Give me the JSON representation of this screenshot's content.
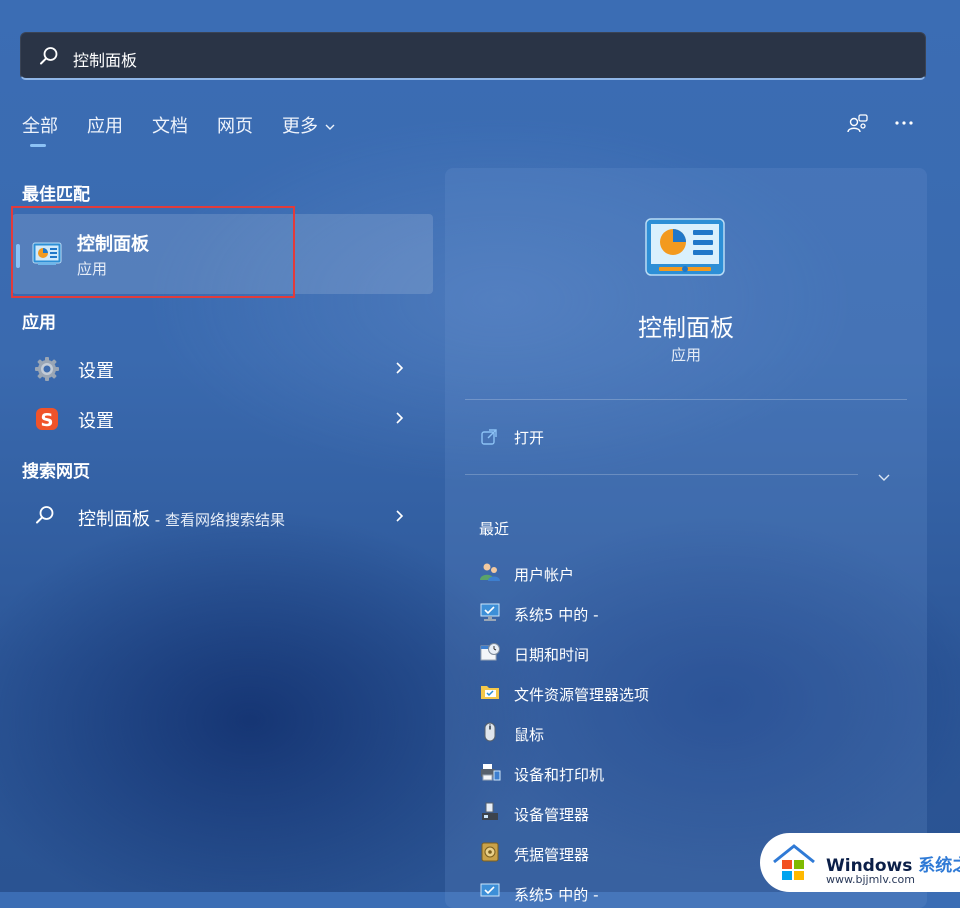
{
  "search": {
    "query": "控制面板"
  },
  "tabs": [
    {
      "label": "全部",
      "active": true
    },
    {
      "label": "应用"
    },
    {
      "label": "文档"
    },
    {
      "label": "网页"
    },
    {
      "label": "更多"
    }
  ],
  "top_icons": [
    "account-switch-icon",
    "more-options-icon"
  ],
  "best_match": {
    "section_title": "最佳匹配",
    "name": "控制面板",
    "type": "应用",
    "icon": "control-panel-icon"
  },
  "apps": {
    "section_title": "应用",
    "items": [
      {
        "label": "设置",
        "icon": "gear-icon"
      },
      {
        "label": "设置",
        "icon": "sogou-s-icon"
      }
    ]
  },
  "web_search": {
    "section_title": "搜索网页",
    "query": "控制面板",
    "suffix": " - 查看网络搜索结果"
  },
  "detail": {
    "name": "控制面板",
    "type": "应用",
    "open_label": "打开",
    "recent_title": "最近",
    "recent": [
      {
        "label": "用户帐户",
        "icon": "users-icon"
      },
      {
        "label": "系统5 中的 -",
        "icon": "monitor-check-icon"
      },
      {
        "label": "日期和时间",
        "icon": "calendar-clock-icon"
      },
      {
        "label": "文件资源管理器选项",
        "icon": "folder-options-icon"
      },
      {
        "label": "鼠标",
        "icon": "mouse-icon"
      },
      {
        "label": "设备和打印机",
        "icon": "printer-icon"
      },
      {
        "label": "设备管理器",
        "icon": "device-manager-icon"
      },
      {
        "label": "凭据管理器",
        "icon": "credential-vault-icon"
      },
      {
        "label": "系统5 中的 -",
        "icon": "monitor-check-icon"
      }
    ]
  },
  "watermark": {
    "brand": "Windows",
    "brand_suffix": "系统之家",
    "url": "www.bjjmlv.com"
  },
  "colors": {
    "accent": "#8cc2f5",
    "highlight_box": "#e23b3b",
    "search_bg": "#2a3446"
  }
}
